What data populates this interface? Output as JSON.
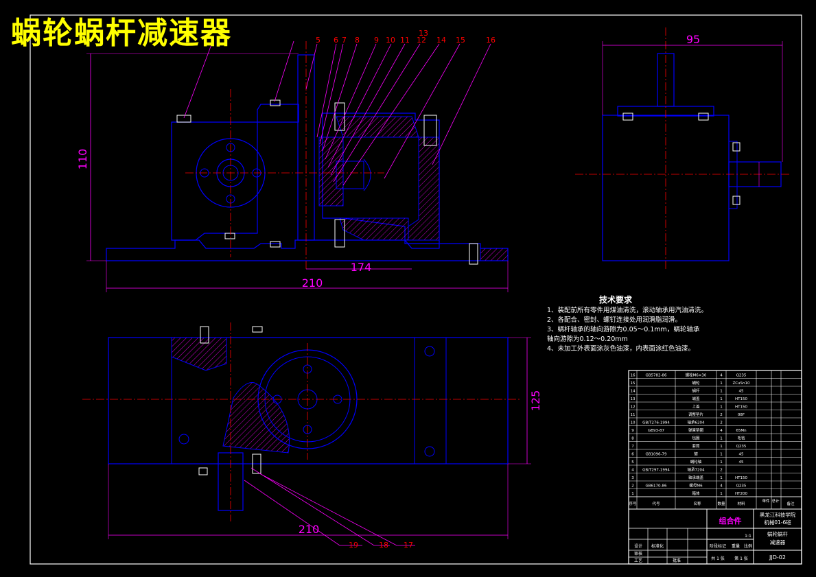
{
  "title": "蜗轮蜗杆减速器",
  "colors": {
    "background": "#000000",
    "outline": "#0000ff",
    "hatch": "#ff00ff",
    "dimension": "#ff00ff",
    "centerline": "#ff0000",
    "leader": "#ff00ff",
    "border": "#ffffff",
    "title": "#ffff00",
    "callout": "#ff0000"
  },
  "callouts_top": [
    "5",
    "6",
    "7",
    "8",
    "9",
    "10",
    "11",
    "12",
    "13",
    "14",
    "15",
    "16"
  ],
  "callouts_bottom": [
    "17",
    "18",
    "19"
  ],
  "dimensions": {
    "front_height": "110",
    "front_width_inner": "174",
    "front_width_total": "210",
    "side_width": "95",
    "top_height": "125",
    "top_width": "210"
  },
  "tech_requirements": {
    "heading": "技术要求",
    "items": [
      "1、装配前所有零件用煤油清洗，滚动轴承用汽油清洗。",
      "2、各配合、密封、螺钉连接处用润滑脂润滑。",
      "3、蜗杆轴承的轴向游隙为0.05～0.1mm，蜗轮轴承",
      "   轴向游隙为0.12～0.20mm",
      "4、未加工外表面涂灰色油漆，内表面涂红色油漆。"
    ]
  },
  "title_block": {
    "assembly_label": "组合件",
    "school": "黑龙江科技学院",
    "class_name": "机械01-6班",
    "drawing_name_1": "蜗轮蜗杆",
    "drawing_name_2": "减速器",
    "drawing_no": "JJD-02",
    "scale": "1:1",
    "sheet_total": "共 1 张",
    "sheet_no": "第 1 张",
    "header_seq": "序号",
    "header_code": "代号",
    "header_name": "名称",
    "header_qty": "数量",
    "header_mat": "材料",
    "header_weight_single": "单件",
    "header_weight_total": "总计",
    "header_remark": "备注",
    "design": "设计",
    "check": "审核",
    "process": "工艺",
    "standard": "标准化",
    "approve": "批准",
    "stage_mark": "阶段标记",
    "weight": "重量",
    "ratio": "比例"
  },
  "bom": [
    {
      "seq": "16",
      "code": "GB5782-86",
      "name": "螺栓M6×30",
      "qty": "4",
      "mat": "Q235"
    },
    {
      "seq": "15",
      "code": "",
      "name": "蜗轮",
      "qty": "1",
      "mat": "ZCuSn10"
    },
    {
      "seq": "14",
      "code": "",
      "name": "蜗杆",
      "qty": "1",
      "mat": "45"
    },
    {
      "seq": "13",
      "code": "",
      "name": "端盖",
      "qty": "1",
      "mat": "HT150"
    },
    {
      "seq": "12",
      "code": "",
      "name": "上盖",
      "qty": "1",
      "mat": "HT150"
    },
    {
      "seq": "11",
      "code": "",
      "name": "调整垫片",
      "qty": "2",
      "mat": "08F"
    },
    {
      "seq": "10",
      "code": "GB/T276-1994",
      "name": "轴承6204",
      "qty": "2",
      "mat": ""
    },
    {
      "seq": "9",
      "code": "GB93-87",
      "name": "弹簧垫圈",
      "qty": "4",
      "mat": "65Mn"
    },
    {
      "seq": "8",
      "code": "",
      "name": "毡圈",
      "qty": "1",
      "mat": "毛毡"
    },
    {
      "seq": "7",
      "code": "",
      "name": "套筒",
      "qty": "1",
      "mat": "Q235"
    },
    {
      "seq": "6",
      "code": "GB1096-79",
      "name": "键",
      "qty": "1",
      "mat": "45"
    },
    {
      "seq": "5",
      "code": "",
      "name": "蜗轮轴",
      "qty": "1",
      "mat": "45"
    },
    {
      "seq": "4",
      "code": "GB/T297-1994",
      "name": "轴承7204",
      "qty": "2",
      "mat": ""
    },
    {
      "seq": "3",
      "code": "",
      "name": "轴承端盖",
      "qty": "1",
      "mat": "HT150"
    },
    {
      "seq": "2",
      "code": "GB6170-86",
      "name": "螺母M6",
      "qty": "4",
      "mat": "Q235"
    },
    {
      "seq": "1",
      "code": "",
      "name": "箱体",
      "qty": "1",
      "mat": "HT200"
    }
  ]
}
